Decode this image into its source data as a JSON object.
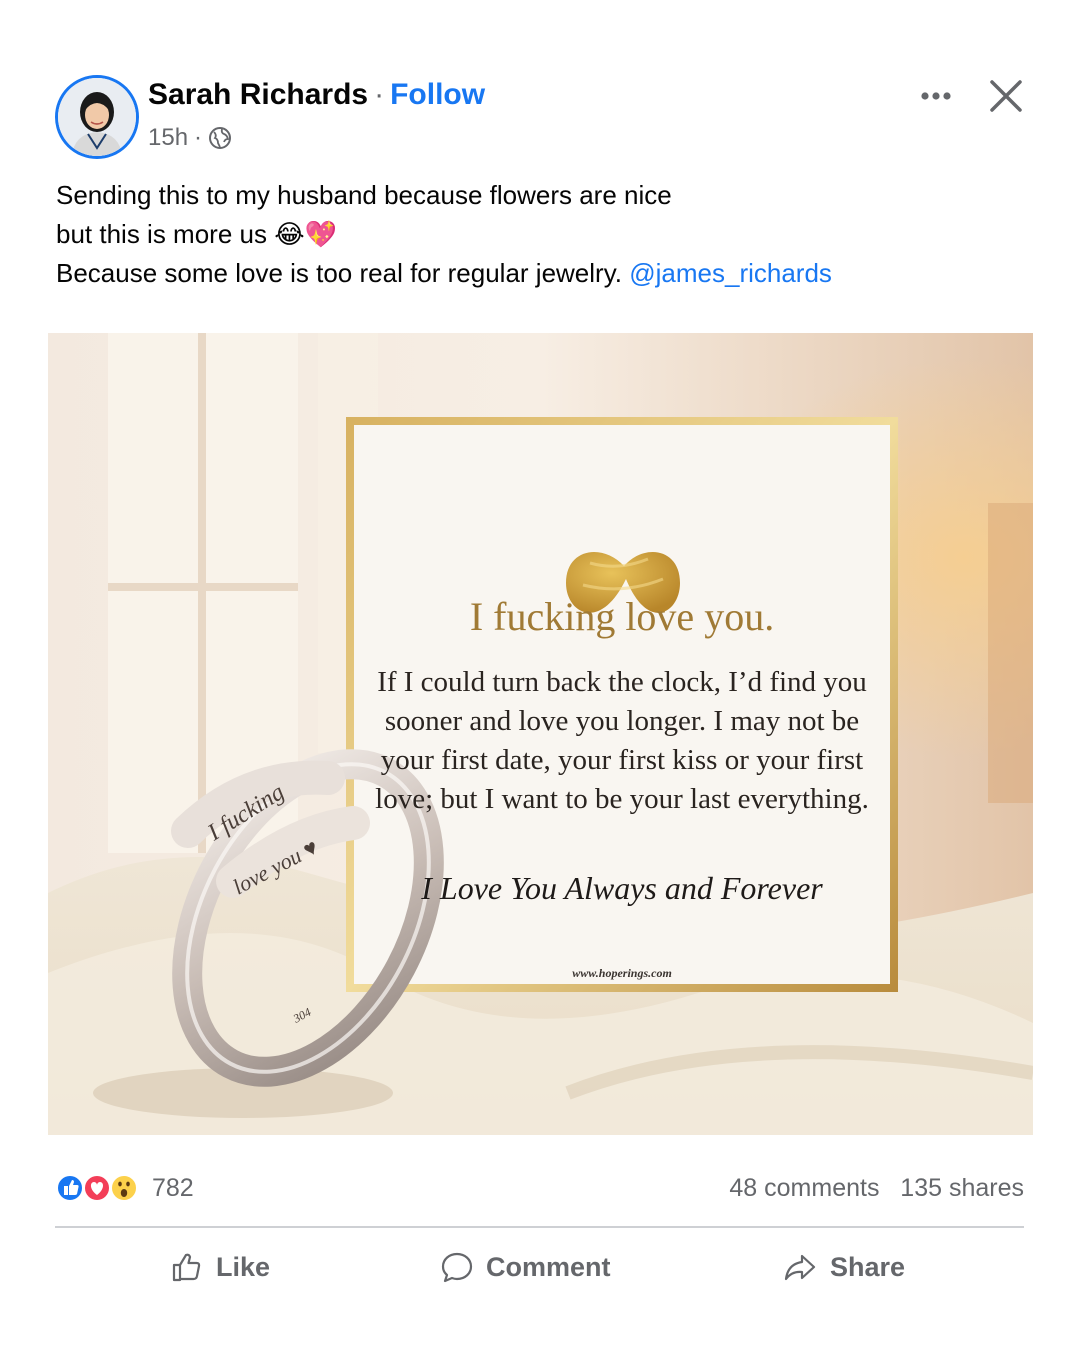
{
  "post": {
    "author": "Sarah Richards",
    "separator": "·",
    "follow_label": "Follow",
    "time": "15h",
    "time_separator": "·",
    "privacy_icon": "globe-icon",
    "caption": {
      "line1": "Sending this to my husband because flowers are nice",
      "line2": "but this is more us",
      "line2_emoji": "😂💖",
      "line3": "Because some love is too real for regular jewelry.",
      "mention": "@james_richards"
    }
  },
  "image": {
    "card_title": "I fucking love you.",
    "card_body": "If I could turn back the clock, I’d find you sooner and love you longer. I may not be your first date, your first kiss or your first love; but I want to be your last everything.",
    "card_script": "I Love You Always and Forever",
    "card_url": "www.hoperings.com",
    "ring_engraving_top": "I fucking",
    "ring_engraving_bottom": "love you",
    "ring_engraving_heart": "♥",
    "ring_stamp": "304"
  },
  "stats": {
    "reaction_icons": [
      "like-icon",
      "love-icon",
      "wow-icon"
    ],
    "reaction_count": "782",
    "comments": "48 comments",
    "shares": "135 shares"
  },
  "actions": {
    "like": "Like",
    "comment": "Comment",
    "share": "Share"
  },
  "colors": {
    "accent": "#1877f2",
    "secondary_text": "#65676b",
    "gold": "#c8a050"
  }
}
